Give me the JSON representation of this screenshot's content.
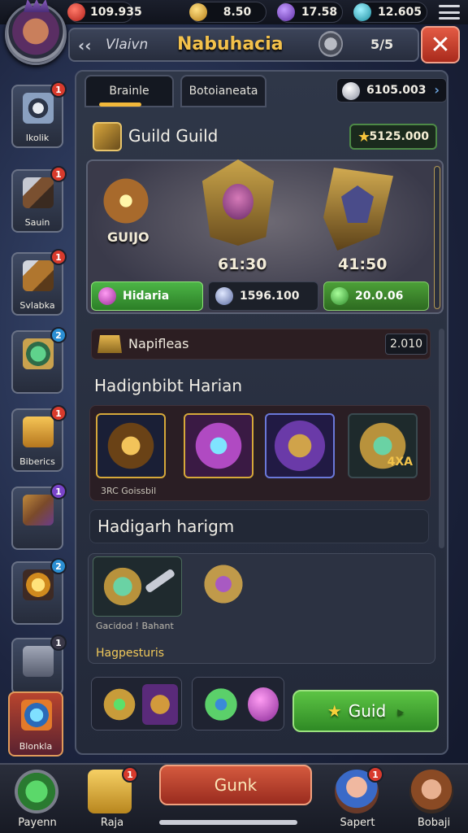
{
  "resources": [
    {
      "name": "ruby",
      "value": "109.935",
      "color": "#d8342c"
    },
    {
      "name": "gold",
      "value": "8.50",
      "color": "#e5b132"
    },
    {
      "name": "amethyst",
      "value": "17.58",
      "color": "#8c5ad6"
    },
    {
      "name": "diamond",
      "value": "12.605",
      "color": "#34b4c4"
    }
  ],
  "header": {
    "back": "‹‹",
    "subtitle": "Vlaivn",
    "title": "Nabuhacia",
    "count": "5/5",
    "close": "✕"
  },
  "sidebar": [
    {
      "label": "Ikolik",
      "badge": "1",
      "badge_color": "red"
    },
    {
      "label": "Sauin",
      "badge": "1",
      "badge_color": "red"
    },
    {
      "label": "Svlabka",
      "badge": "1",
      "badge_color": "red"
    },
    {
      "label": "",
      "badge": "2",
      "badge_color": "blue"
    },
    {
      "label": "Biberics",
      "badge": "1",
      "badge_color": "red"
    },
    {
      "label": "",
      "badge": "1",
      "badge_color": "purple"
    },
    {
      "label": "",
      "badge": "2",
      "badge_color": "blue"
    },
    {
      "label": "",
      "badge": "1",
      "badge_color": "dark"
    },
    {
      "label": "Blonkla",
      "badge": "",
      "badge_color": ""
    }
  ],
  "tabs": [
    "Brainle",
    "Botoianeata"
  ],
  "tab_currency": {
    "value": "6105.003",
    "arrow": "›"
  },
  "guild": {
    "title": "Guild Guild",
    "gold": "5125.000",
    "showcase": {
      "left_label": "GUIJO",
      "price_1": "61:30",
      "price_2": "41:50"
    },
    "stats": [
      {
        "label": "Hidaria",
        "color": "#3f9b3a"
      },
      {
        "label": "1596.100",
        "color": "#1c2029"
      },
      {
        "label": "20.0.06",
        "color": "#3f8a2a"
      }
    ]
  },
  "napifleas": {
    "title": "Napifleas",
    "value": "2.010"
  },
  "section1": {
    "title": "Hadignbibt Harian",
    "caption": "3RC Goissbil",
    "item_tag": "4XA"
  },
  "section2": {
    "title": "Hadigarh harigm"
  },
  "lower": {
    "caption": "Gacidod ! Bahant",
    "label": "Hagpesturis"
  },
  "guild_button": {
    "star": "★",
    "label": "Guid",
    "arrow": "▸"
  },
  "bottom": {
    "left_1": "Payenn",
    "left_2": "Raja",
    "center": "Gunk",
    "right_1": "Sapert",
    "right_2": "Bobaji",
    "badge_1": "1",
    "badge_2": "1"
  }
}
